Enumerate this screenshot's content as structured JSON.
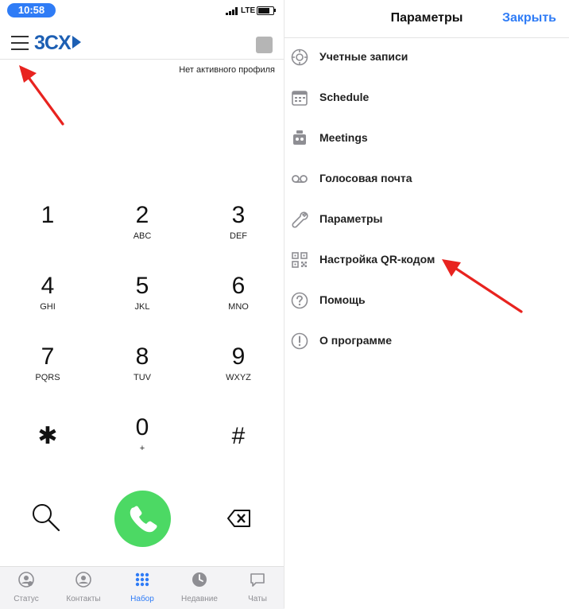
{
  "status_bar": {
    "time": "10:58",
    "network": "LTE"
  },
  "dialer": {
    "brand": "3CX",
    "profile_status": "Нет активного профиля",
    "keys": [
      {
        "digit": "1",
        "letters": ""
      },
      {
        "digit": "2",
        "letters": "ABC"
      },
      {
        "digit": "3",
        "letters": "DEF"
      },
      {
        "digit": "4",
        "letters": "GHI"
      },
      {
        "digit": "5",
        "letters": "JKL"
      },
      {
        "digit": "6",
        "letters": "MNO"
      },
      {
        "digit": "7",
        "letters": "PQRS"
      },
      {
        "digit": "8",
        "letters": "TUV"
      },
      {
        "digit": "9",
        "letters": "WXYZ"
      },
      {
        "digit": "✱",
        "letters": ""
      },
      {
        "digit": "0",
        "letters": "+"
      },
      {
        "digit": "#",
        "letters": ""
      }
    ],
    "call_color": "#4cd964"
  },
  "tabbar": {
    "items": [
      {
        "label": "Статус",
        "icon": "status-icon"
      },
      {
        "label": "Контакты",
        "icon": "contacts-icon"
      },
      {
        "label": "Набор",
        "icon": "dialpad-icon",
        "active": true
      },
      {
        "label": "Недавние",
        "icon": "clock-icon"
      },
      {
        "label": "Чаты",
        "icon": "chat-icon"
      }
    ],
    "active_color": "#2f7cf6"
  },
  "settings": {
    "title": "Параметры",
    "close": "Закрыть",
    "items": [
      {
        "label": "Учетные записи",
        "icon": "accounts-icon"
      },
      {
        "label": "Schedule",
        "icon": "calendar-icon"
      },
      {
        "label": "Meetings",
        "icon": "meetings-icon"
      },
      {
        "label": "Голосовая почта",
        "icon": "voicemail-icon"
      },
      {
        "label": "Параметры",
        "icon": "wrench-icon"
      },
      {
        "label": "Настройка QR-кодом",
        "icon": "qr-code-icon"
      },
      {
        "label": "Помощь",
        "icon": "help-icon"
      },
      {
        "label": "О программе",
        "icon": "info-icon"
      }
    ]
  },
  "annotation_color": "#e8231f"
}
